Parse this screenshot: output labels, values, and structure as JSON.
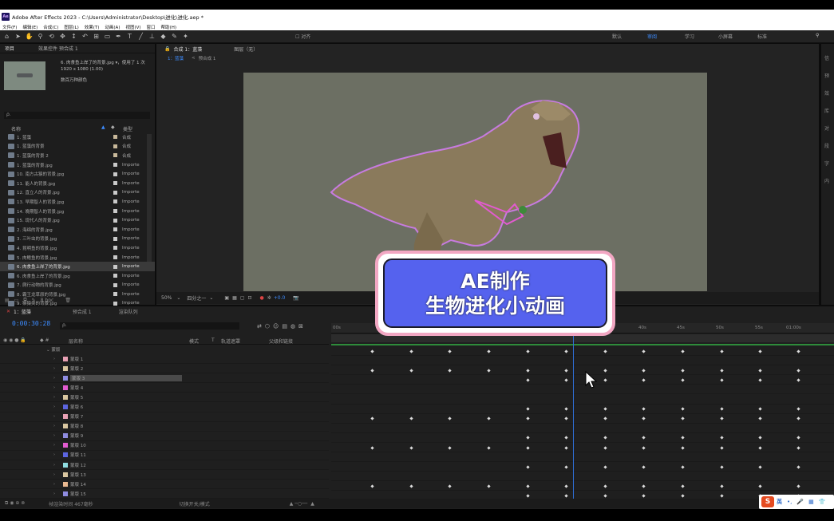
{
  "window": {
    "title": "Adobe After Effects 2023 - C:\\Users\\Administrator\\Desktop\\进化\\进化.aep *",
    "app_icon": "Ae"
  },
  "menu": [
    "文件(F)",
    "编辑(E)",
    "合成(C)",
    "图层(L)",
    "效果(T)",
    "动画(A)",
    "视图(V)",
    "窗口",
    "帮助(H)"
  ],
  "toolbar": {
    "align_label": "对齐",
    "workspaces": [
      "默认",
      "审阅",
      "学习",
      "小屏幕",
      "标准"
    ],
    "active_workspace": "审阅"
  },
  "project_panel": {
    "tab_label": "项目",
    "effects_tab": "效果控件 预合成 1",
    "selected_item_name": "6. 肉食鱼上岸了的背景.jpg",
    "selected_item_used": "▾，使用了 1 次",
    "selected_item_dims": "1920 x 1080 (1.00)",
    "selected_item_colors": "数百万种颜色",
    "search_placeholder": "ρ.",
    "col_name": "名称",
    "col_type": "类型",
    "items": [
      {
        "name": "1. 蓝藻",
        "type": "合成",
        "swatch": "#c8b89a",
        "sel": false
      },
      {
        "name": "1. 蓝藻的背景",
        "type": "合成",
        "swatch": "#c8b89a",
        "sel": false
      },
      {
        "name": "1. 蓝藻的背景 2",
        "type": "合成",
        "swatch": "#c8b89a",
        "sel": false
      },
      {
        "name": "1. 蓝藻的背景.jpg",
        "type": "Importe",
        "swatch": "#c9c9c9",
        "sel": false
      },
      {
        "name": "10. 南方古猿的背景.jpg",
        "type": "Importe",
        "swatch": "#c9c9c9",
        "sel": false
      },
      {
        "name": "11. 能人的背景.jpg",
        "type": "Importe",
        "swatch": "#c9c9c9",
        "sel": false
      },
      {
        "name": "12. 直立人的背景.jpg",
        "type": "Importe",
        "swatch": "#c9c9c9",
        "sel": false
      },
      {
        "name": "13. 早期智人的背景.jpg",
        "type": "Importe",
        "swatch": "#c9c9c9",
        "sel": false
      },
      {
        "name": "14. 晚期智人的背景.jpg",
        "type": "Importe",
        "swatch": "#c9c9c9",
        "sel": false
      },
      {
        "name": "15. 现代人的背景.jpg",
        "type": "Importe",
        "swatch": "#c9c9c9",
        "sel": false
      },
      {
        "name": "2. 海绵的背景.jpg",
        "type": "Importe",
        "swatch": "#c9c9c9",
        "sel": false
      },
      {
        "name": "3. 三叶虫的背景.jpg",
        "type": "Importe",
        "swatch": "#c9c9c9",
        "sel": false
      },
      {
        "name": "4. 昆明鱼的背景.jpg",
        "type": "Importe",
        "swatch": "#c9c9c9",
        "sel": false
      },
      {
        "name": "5. 肉鳍鱼的背景.jpg",
        "type": "Importe",
        "swatch": "#c9c9c9",
        "sel": false
      },
      {
        "name": "6. 肉食鱼上岸了的背景.jpg",
        "type": "Importe",
        "swatch": "#c9c9c9",
        "sel": true
      },
      {
        "name": "6. 肉食鱼上岸了的背景.jpg",
        "type": "Importe",
        "swatch": "#c9c9c9",
        "sel": false
      },
      {
        "name": "7. 爬行动物的背景.jpg",
        "type": "Importe",
        "swatch": "#c9c9c9",
        "sel": false
      },
      {
        "name": "8. 霸王龙草原的背景.jpg",
        "type": "Importe",
        "swatch": "#c9c9c9",
        "sel": false
      },
      {
        "name": "9. 猴猿类的背景.jpg",
        "type": "Importe",
        "swatch": "#c9c9c9",
        "sel": false
      }
    ],
    "footer_bpc": "8 bpc"
  },
  "comp_panel": {
    "comp_tab": "合成 1：蓝藻",
    "layer_tab": "图层（无）",
    "breadcrumb_1": "1：蓝藻",
    "breadcrumb_2": "预合成 1",
    "zoom": "50%",
    "resolution": "四分之一",
    "exposure": "+0.0",
    "canvas_color": "#6c6f63"
  },
  "right_panel": [
    "信",
    "预",
    "效",
    "库",
    "对",
    "段",
    "字",
    "内"
  ],
  "timeline": {
    "tab_comp": "1：蓝藻",
    "tab_precomp": "预合成 1",
    "tab_render": "渲染队列",
    "timecode": "0:00:30:28",
    "search_placeholder": "ρ.",
    "col_layer_name": "层名称",
    "col_mode": "模式",
    "col_t": "T",
    "col_track_matte": "轨道遮罩",
    "col_parent": "父级和链接",
    "group_label": "蒙版",
    "layers": [
      {
        "name": "蒙版 1",
        "color": "#e8a0b4"
      },
      {
        "name": "蒙版 2",
        "color": "#d9c6a0"
      },
      {
        "name": "蒙版 3",
        "color": "#8f8ce0"
      },
      {
        "name": "蒙版 4",
        "color": "#e25bd0"
      },
      {
        "name": "蒙版 5",
        "color": "#d9c6a0"
      },
      {
        "name": "蒙版 6",
        "color": "#5c65e0"
      },
      {
        "name": "蒙版 7",
        "color": "#e8a0b4"
      },
      {
        "name": "蒙版 8",
        "color": "#d9c6a0"
      },
      {
        "name": "蒙版 9",
        "color": "#8f8ce0"
      },
      {
        "name": "蒙版 10",
        "color": "#e25bd0"
      },
      {
        "name": "蒙版 11",
        "color": "#5c65e0"
      },
      {
        "name": "蒙版 12",
        "color": "#8fdde0"
      },
      {
        "name": "蒙版 13",
        "color": "#d9c6a0"
      },
      {
        "name": "蒙版 14",
        "color": "#e8b890"
      },
      {
        "name": "蒙版 15",
        "color": "#8f8ce0"
      }
    ],
    "ruler_labels": [
      "00s",
      "40s",
      "45s",
      "50s",
      "55s",
      "01:00s"
    ],
    "footer_render_time": "帧渲染时间 467毫秒",
    "footer_toggle": "切换开关/模式"
  },
  "overlay": {
    "line1": "AE制作",
    "line2": "生物进化小动画"
  },
  "ime": {
    "logo": "S",
    "lang": "英"
  }
}
